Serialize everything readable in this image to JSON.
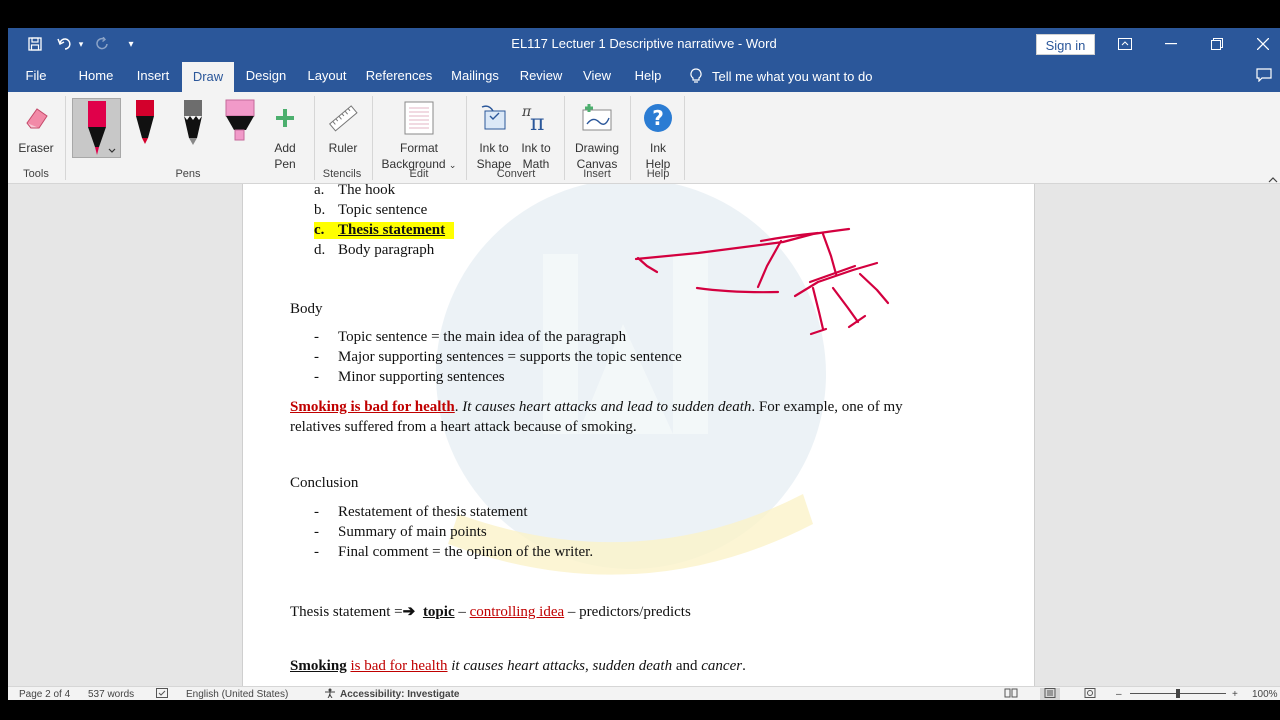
{
  "window": {
    "title": "EL117 Lectuer 1 Descriptive narrativve  -  Word",
    "sign_in": "Sign in"
  },
  "tabs": [
    {
      "label": "File"
    },
    {
      "label": "Home"
    },
    {
      "label": "Insert"
    },
    {
      "label": "Draw"
    },
    {
      "label": "Design"
    },
    {
      "label": "Layout"
    },
    {
      "label": "References"
    },
    {
      "label": "Mailings"
    },
    {
      "label": "Review"
    },
    {
      "label": "View"
    },
    {
      "label": "Help"
    }
  ],
  "active_tab": "Draw",
  "tell_me": "Tell me what you want to do",
  "ribbon": {
    "eraser": "Eraser",
    "add_pen": [
      "Add",
      "Pen"
    ],
    "ruler": "Ruler",
    "format_background": [
      "Format",
      "Background"
    ],
    "ink_to_shape": [
      "Ink to",
      "Shape"
    ],
    "ink_to_math": [
      "Ink to",
      "Math"
    ],
    "drawing_canvas": [
      "Drawing",
      "Canvas"
    ],
    "ink_help": [
      "Ink",
      "Help"
    ],
    "groups": {
      "tools": "Tools",
      "pens": "Pens",
      "stencils": "Stencils",
      "edit": "Edit",
      "convert": "Convert",
      "insert": "Insert",
      "help": "Help"
    },
    "pen_colors": [
      "#e0004a",
      "#d3002c",
      "#6d6d6d",
      "#f19ac9"
    ]
  },
  "document": {
    "intro_list": [
      {
        "marker": "a.",
        "text": "The hook"
      },
      {
        "marker": "b.",
        "text": "Topic sentence"
      },
      {
        "marker": "c.",
        "text": "Thesis statement"
      },
      {
        "marker": "d.",
        "text": "Body paragraph"
      }
    ],
    "body_heading": "Body",
    "body_list": [
      {
        "marker": "-",
        "text": "Topic sentence = the main idea of the paragraph"
      },
      {
        "marker": "-",
        "text": "Major supporting sentences = supports the topic sentence"
      },
      {
        "marker": "-",
        "text": "Minor supporting sentences"
      }
    ],
    "example": {
      "topic": "Smoking is bad for health",
      "dot": ".",
      "support": " It causes heart attacks and lead to sudden death",
      "rest1": ". For example, one of my",
      "rest2": "relatives suffered from a heart attack because of smoking."
    },
    "conclusion_heading": "Conclusion",
    "conclusion_list": [
      {
        "marker": "-",
        "text": "Restatement of thesis statement"
      },
      {
        "marker": "-",
        "text": "Summary of main points"
      },
      {
        "marker": "-",
        "text": "Final comment = the opinion of the writer."
      }
    ],
    "thesis_formula": {
      "lead": "Thesis statement =",
      "arrow": "➔",
      "topic": "topic",
      "dash1": " – ",
      "controlling": "controlling idea",
      "dash2": " – predictors/predicts"
    },
    "last_line": {
      "a": "Smoking",
      "b": "is bad for health",
      "c": " it causes heart attacks",
      "d": ", ",
      "e": "sudden death",
      "f": " and ",
      "g": "cancer",
      "h": "."
    }
  },
  "status": {
    "page": "Page 2 of 4",
    "words": "537 words",
    "language": "English (United States)",
    "accessibility": "Accessibility: Investigate",
    "zoom": "100%"
  },
  "colors": {
    "accent": "#2b579a",
    "ink": "#d3003f",
    "highlight": "#ffff00",
    "red_text": "#c00000"
  }
}
